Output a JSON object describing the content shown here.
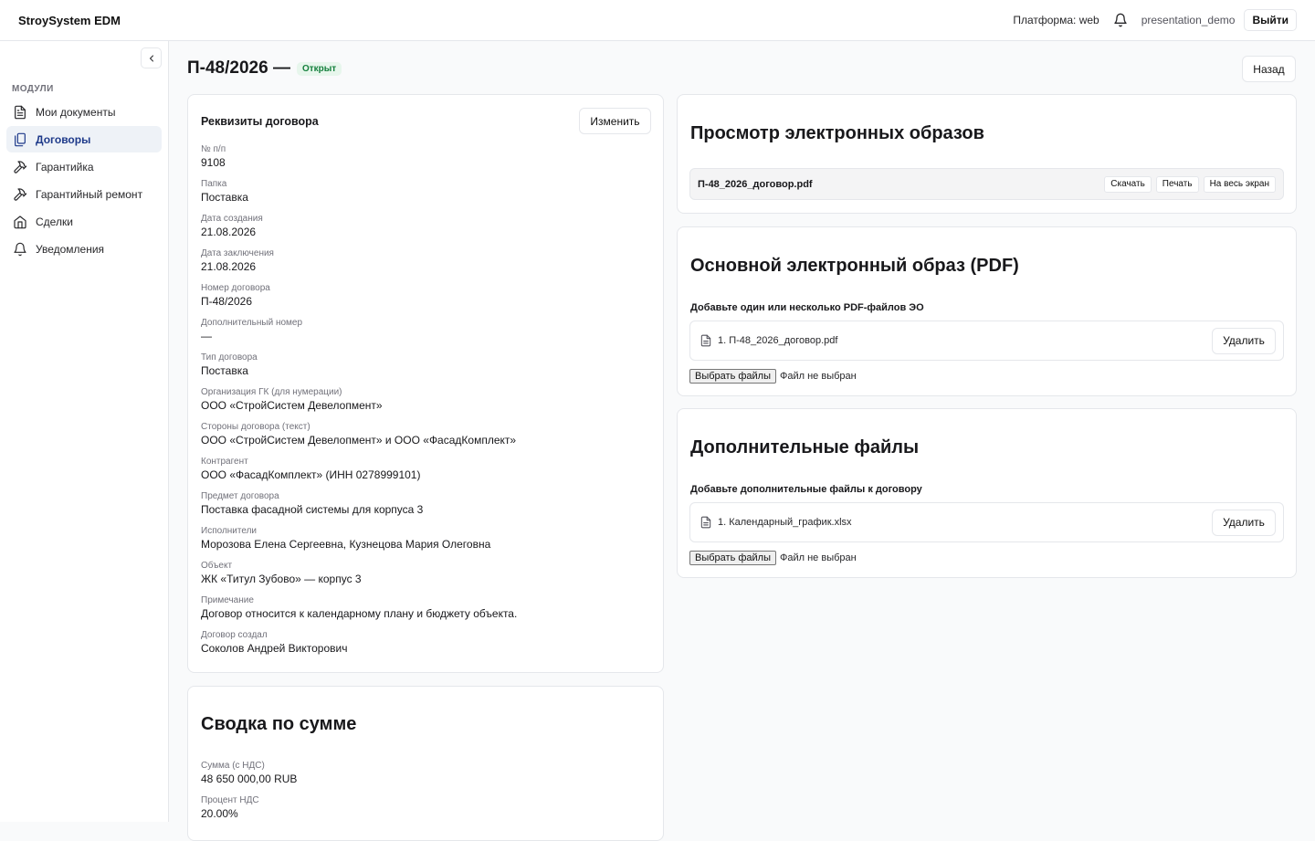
{
  "header": {
    "brand": "StroySystem EDM",
    "platform": "Платформа: web",
    "username": "presentation_demo",
    "logout_label": "Выйти"
  },
  "sidebar": {
    "section_label": "МОДУЛИ",
    "items": [
      {
        "label": "Мои документы",
        "icon": "document-icon"
      },
      {
        "label": "Договоры",
        "icon": "files-icon",
        "active": true
      },
      {
        "label": "Гарантийка",
        "icon": "hammer-icon"
      },
      {
        "label": "Гарантийный ремонт",
        "icon": "hammer-icon"
      },
      {
        "label": "Сделки",
        "icon": "home-icon"
      },
      {
        "label": "Уведомления",
        "icon": "bell-icon"
      }
    ]
  },
  "page": {
    "title": "П-48/2026 —",
    "status": "Открыт",
    "back_label": "Назад"
  },
  "details": {
    "title": "Реквизиты договора",
    "edit_label": "Изменить",
    "fields": [
      {
        "label": "№ п/п",
        "value": "9108"
      },
      {
        "label": "Папка",
        "value": "Поставка"
      },
      {
        "label": "Дата создания",
        "value": "21.08.2026"
      },
      {
        "label": "Дата заключения",
        "value": "21.08.2026"
      },
      {
        "label": "Номер договора",
        "value": "П-48/2026"
      },
      {
        "label": "Дополнительный номер",
        "value": "—"
      },
      {
        "label": "Тип договора",
        "value": "Поставка"
      },
      {
        "label": "Организация ГК (для нумерации)",
        "value": "ООО «СтройСистем Девелопмент»"
      },
      {
        "label": "Стороны договора (текст)",
        "value": "ООО «СтройСистем Девелопмент» и ООО «ФасадКомплект»"
      },
      {
        "label": "Контрагент",
        "value": "ООО «ФасадКомплект» (ИНН 0278999101)"
      },
      {
        "label": "Предмет договора",
        "value": "Поставка фасадной системы для корпуса 3"
      },
      {
        "label": "Исполнители",
        "value": "Морозова Елена Сергеевна, Кузнецова Мария Олеговна"
      },
      {
        "label": "Объект",
        "value": "ЖК «Титул Зубово» — корпус 3"
      },
      {
        "label": "Примечание",
        "value": "Договор относится к календарному плану и бюджету объекта."
      },
      {
        "label": "Договор создал",
        "value": "Соколов Андрей Викторович"
      }
    ]
  },
  "summary": {
    "title": "Сводка по сумме",
    "fields": [
      {
        "label": "Сумма (с НДС)",
        "value": "48 650 000,00 RUB"
      },
      {
        "label": "Процент НДС",
        "value": "20.00%"
      }
    ]
  },
  "viewer": {
    "title": "Просмотр электронных образов",
    "filename": "П-48_2026_договор.pdf",
    "download_label": "Скачать",
    "print_label": "Печать",
    "fullscreen_label": "На весь экран"
  },
  "main_pdf": {
    "title": "Основной электронный образ (PDF)",
    "subtitle": "Добавьте один или несколько PDF-файлов ЭО",
    "file": "1. П-48_2026_договор.pdf",
    "delete_label": "Удалить",
    "choose_label": "Выбрать файлы",
    "no_file": "Файл не выбран"
  },
  "extra_files": {
    "title": "Дополнительные файлы",
    "subtitle": "Добавьте дополнительные файлы к договору",
    "file": "1. Календарный_график.xlsx",
    "delete_label": "Удалить",
    "choose_label": "Выбрать файлы",
    "no_file": "Файл не выбран"
  }
}
